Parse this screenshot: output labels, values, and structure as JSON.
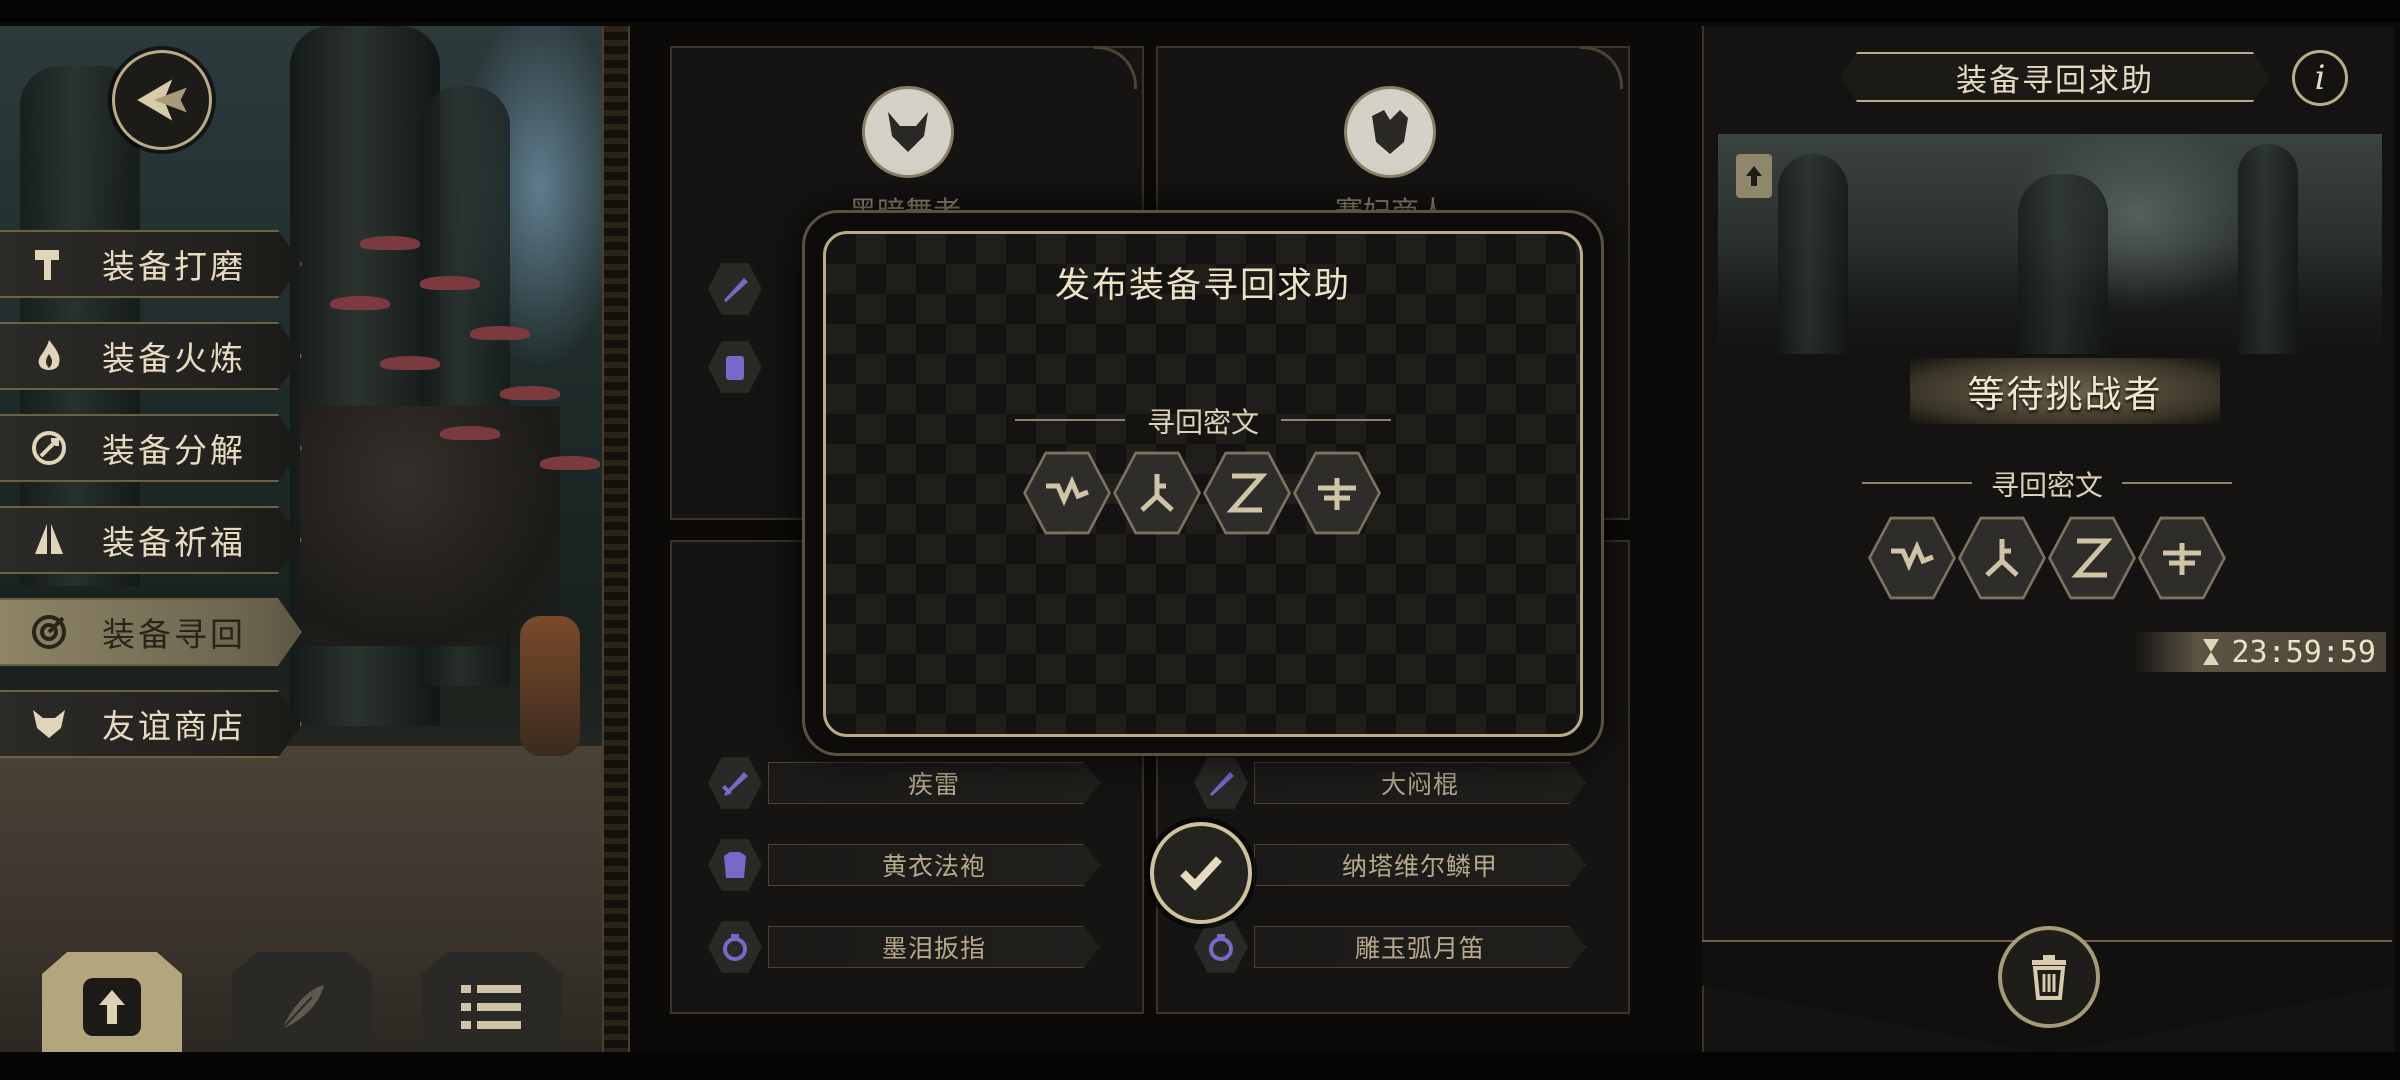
{
  "menu": {
    "items": [
      {
        "label": "装备打磨",
        "icon": "hammer-icon",
        "active": false
      },
      {
        "label": "装备火炼",
        "icon": "flame-icon",
        "active": false
      },
      {
        "label": "装备分解",
        "icon": "disassemble-icon",
        "active": false
      },
      {
        "label": "装备祈福",
        "icon": "pray-hands-icon",
        "active": false
      },
      {
        "label": "装备寻回",
        "icon": "retrieve-target-icon",
        "active": true
      },
      {
        "label": "友谊商店",
        "icon": "fox-icon",
        "active": false
      }
    ]
  },
  "toolbar": {
    "buttons": [
      {
        "icon": "upload-icon",
        "selected": true
      },
      {
        "icon": "feather-icon",
        "selected": false
      },
      {
        "icon": "list-icon",
        "selected": false
      }
    ]
  },
  "cards": {
    "left": {
      "name": "黑暗舞者",
      "slots": [
        "疾雷",
        "黄衣法袍",
        "墨泪扳指"
      ]
    },
    "right": {
      "name": "赛妇商人",
      "slots": [
        "大闷棍",
        "纳塔维尔鳞甲",
        "雕玉弧月笛"
      ]
    }
  },
  "dialog": {
    "title": "发布装备寻回求助",
    "cipher_label": "寻回密文",
    "runes": [
      "rune-zigzag-icon",
      "rune-fork-icon",
      "rune-hourglass-icon",
      "rune-arrow-icon"
    ]
  },
  "right_panel": {
    "title": "装备寻回求助",
    "info": "i",
    "status": "等待挑战者",
    "cipher_label": "寻回密文",
    "runes": [
      "rune-zigzag-icon",
      "rune-fork-icon",
      "rune-hourglass-icon",
      "rune-arrow-icon"
    ],
    "timer": "23:59:59"
  },
  "colors": {
    "accent_gold": "#b9ad88",
    "active_menu": "#8e8566",
    "slot_icon_purple": "#7a68c8"
  }
}
